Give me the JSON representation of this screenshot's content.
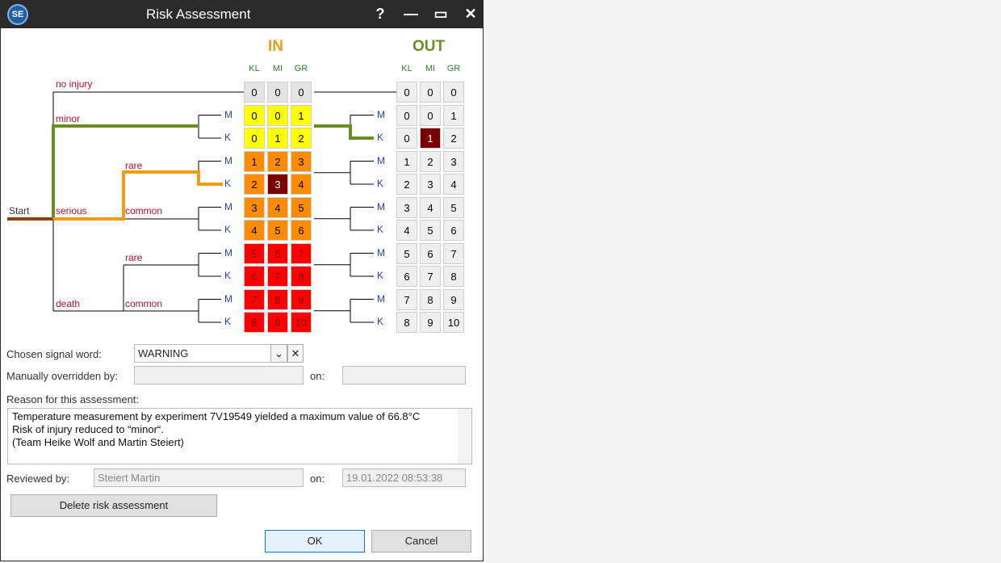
{
  "window": {
    "title": "Risk Assessment",
    "app_icon_text": "SE",
    "help_glyph": "?",
    "minimize_glyph": "—",
    "maximize_glyph": "▭",
    "close_glyph": "✕"
  },
  "matrix": {
    "in_title": "IN",
    "out_title": "OUT",
    "cols": [
      "KL",
      "MI",
      "GR"
    ],
    "in_rows": [
      {
        "values": [
          "0",
          "0",
          "0"
        ],
        "colors": [
          "#e4e4e4",
          "#e4e4e4",
          "#e4e4e4"
        ]
      },
      {
        "values": [
          "0",
          "0",
          "1"
        ],
        "colors": [
          "#ffff00",
          "#ffff00",
          "#ffff00"
        ]
      },
      {
        "values": [
          "0",
          "1",
          "2"
        ],
        "colors": [
          "#ffff00",
          "#ffff00",
          "#ffff00"
        ]
      },
      {
        "values": [
          "1",
          "2",
          "3"
        ],
        "colors": [
          "#ff8c00",
          "#ff8c00",
          "#ff8c00"
        ]
      },
      {
        "values": [
          "2",
          "3",
          "4"
        ],
        "colors": [
          "#ff8c00",
          "#7a0000",
          "#ff8c00"
        ]
      },
      {
        "values": [
          "3",
          "4",
          "5"
        ],
        "colors": [
          "#ff8c00",
          "#ff8c00",
          "#ff8c00"
        ]
      },
      {
        "values": [
          "4",
          "5",
          "6"
        ],
        "colors": [
          "#ff8c00",
          "#ff8c00",
          "#ff8c00"
        ]
      },
      {
        "values": [
          "5",
          "6",
          "7"
        ],
        "colors": [
          "#ff0000",
          "#ff0000",
          "#ff0000"
        ]
      },
      {
        "values": [
          "6",
          "7",
          "8"
        ],
        "colors": [
          "#ff0000",
          "#ff0000",
          "#ff0000"
        ]
      },
      {
        "values": [
          "7",
          "8",
          "9"
        ],
        "colors": [
          "#ff0000",
          "#ff0000",
          "#ff0000"
        ]
      },
      {
        "values": [
          "8",
          "9",
          "10"
        ],
        "colors": [
          "#ff0000",
          "#ff0000",
          "#ff0000"
        ]
      }
    ],
    "out_rows": [
      [
        "0",
        "0",
        "0"
      ],
      [
        "0",
        "0",
        "1"
      ],
      [
        "0",
        "1",
        "2"
      ],
      [
        "1",
        "2",
        "3"
      ],
      [
        "2",
        "3",
        "4"
      ],
      [
        "3",
        "4",
        "5"
      ],
      [
        "4",
        "5",
        "6"
      ],
      [
        "5",
        "6",
        "7"
      ],
      [
        "6",
        "7",
        "8"
      ],
      [
        "7",
        "8",
        "9"
      ],
      [
        "8",
        "9",
        "10"
      ]
    ],
    "in_selected": {
      "row": 4,
      "col": 1
    },
    "out_selected": {
      "row": 2,
      "col": 1
    },
    "row_markers": [
      "",
      "M",
      "K",
      "M",
      "K",
      "M",
      "K",
      "M",
      "K",
      "M",
      "K"
    ]
  },
  "tree_labels": {
    "start": "Start",
    "no_injury": "no injury",
    "minor": "minor",
    "serious": "serious",
    "death": "death",
    "rare_1": "rare",
    "common_1": "common",
    "rare_2": "rare",
    "common_2": "common"
  },
  "colors": {
    "green_path": "#6b8e23",
    "orange_path": "#f39c12",
    "start_path": "#8b4513",
    "selected_cell": "#7a0000"
  },
  "form": {
    "signal_word_label": "Chosen signal word:",
    "signal_word_value": "WARNING",
    "overridden_label": "Manually overridden by:",
    "overridden_value": "",
    "overridden_on_label": "on:",
    "overridden_on_value": "",
    "reason_label": "Reason for this assessment:",
    "reason_lines": [
      "Temperature measurement by experiment 7V19549 yielded a maximum value of 66.8°C",
      "Risk of injury reduced to “minor“.",
      "(Team Heike Wolf and Martin Steiert)"
    ],
    "reviewed_label": "Reviewed by:",
    "reviewed_value": "Steiert Martin",
    "reviewed_on_label": "on:",
    "reviewed_on_value": "19.01.2022 08:53:38"
  },
  "buttons": {
    "delete": "Delete risk assessment",
    "ok": "OK",
    "cancel": "Cancel"
  }
}
